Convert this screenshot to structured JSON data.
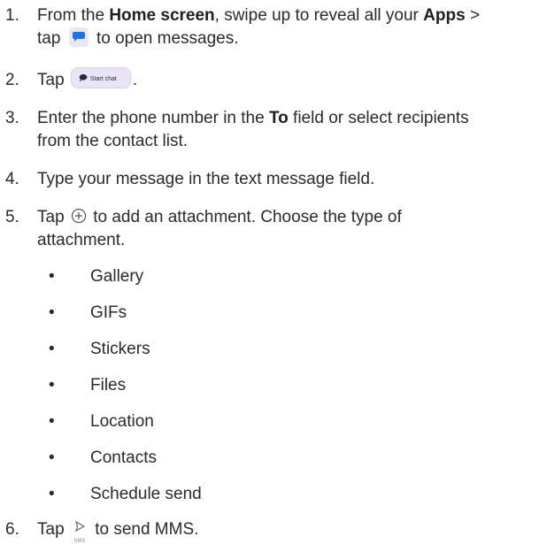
{
  "steps": [
    {
      "num": "1.",
      "parts": {
        "a": "From the ",
        "b": "Home screen",
        "c": ", swipe up to reveal all your ",
        "d": "Apps",
        "e": " >",
        "f": "tap ",
        "g": " to open messages."
      }
    },
    {
      "num": "2.",
      "parts": {
        "a": "Tap ",
        "button_label": "Start chat",
        "b": "."
      }
    },
    {
      "num": "3.",
      "parts": {
        "a": "Enter the phone number in the ",
        "b": "To",
        "c": " field or select recipients",
        "d": "from the contact list."
      }
    },
    {
      "num": "4.",
      "parts": {
        "a": "Type your message in the text message field."
      }
    },
    {
      "num": "5.",
      "parts": {
        "a": "Tap ",
        "b": " to add an attachment. Choose the type of",
        "c": "attachment."
      }
    },
    {
      "num": "6.",
      "parts": {
        "a": "Tap ",
        "icon_sub": "SMS",
        "b": " to send MMS."
      }
    }
  ],
  "attachment_types": [
    "Gallery",
    "GIFs",
    "Stickers",
    "Files",
    "Location",
    "Contacts",
    "Schedule send"
  ],
  "colors": {
    "messages_icon": "#1a73e8",
    "start_chat_bg": "#eae4f7",
    "text": "#2a2a2a"
  },
  "icons": {
    "messages": "messages-app-icon",
    "add": "plus-circle-icon",
    "send": "send-sms-icon",
    "chat": "chat-bubble-icon"
  }
}
